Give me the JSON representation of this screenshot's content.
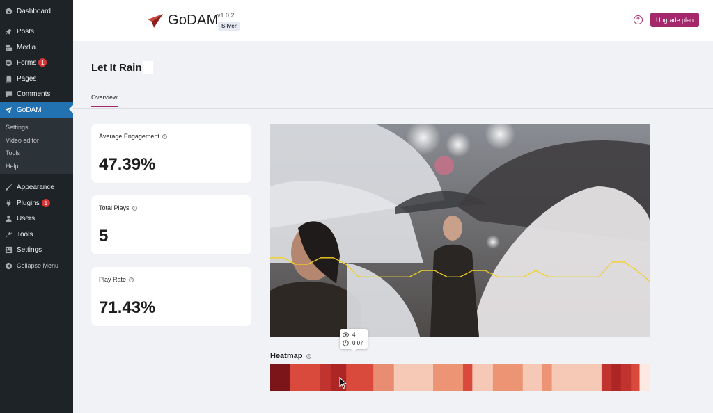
{
  "sidebar": {
    "items": [
      {
        "label": "Dashboard",
        "icon": "dashboard-icon"
      },
      {
        "label": "Posts",
        "icon": "pin-icon"
      },
      {
        "label": "Media",
        "icon": "media-icon"
      },
      {
        "label": "Forms",
        "icon": "forms-icon",
        "badge": "1"
      },
      {
        "label": "Pages",
        "icon": "pages-icon"
      },
      {
        "label": "Comments",
        "icon": "comments-icon"
      },
      {
        "label": "GoDAM",
        "icon": "rocket-icon",
        "active": true
      },
      {
        "label": "Appearance",
        "icon": "brush-icon"
      },
      {
        "label": "Plugins",
        "icon": "plugin-icon",
        "badge": "1"
      },
      {
        "label": "Users",
        "icon": "users-icon"
      },
      {
        "label": "Tools",
        "icon": "wrench-icon"
      },
      {
        "label": "Settings",
        "icon": "settings-icon"
      },
      {
        "label": "Collapse Menu",
        "icon": "collapse-icon"
      }
    ],
    "submenu": [
      "Settings",
      "Video editor",
      "Tools",
      "Help"
    ]
  },
  "header": {
    "logo_text": "GoDAM",
    "version": "v1.0.2",
    "plan": "Silver",
    "help": "?",
    "upgrade_label": "Upgrade plan"
  },
  "page": {
    "title": "Let It Rain",
    "tab": "Overview"
  },
  "metrics": [
    {
      "label": "Average Engagement",
      "value": "47.39%"
    },
    {
      "label": "Total Plays",
      "value": "5"
    },
    {
      "label": "Play Rate",
      "value": "71.43%"
    }
  ],
  "tooltip": {
    "views": "4",
    "time": "0:07"
  },
  "heatmap": {
    "label": "Heatmap",
    "segments": [
      {
        "share": 0.052,
        "color": "#7b1519"
      },
      {
        "share": 0.077,
        "color": "#d9493c"
      },
      {
        "share": 0.027,
        "color": "#c0332e"
      },
      {
        "share": 0.04,
        "color": "#ad2626"
      },
      {
        "share": 0.07,
        "color": "#d9493c"
      },
      {
        "share": 0.053,
        "color": "#e98d72"
      },
      {
        "share": 0.101,
        "color": "#f5c9b6"
      },
      {
        "share": 0.077,
        "color": "#ec9474"
      },
      {
        "share": 0.024,
        "color": "#d9493c"
      },
      {
        "share": 0.053,
        "color": "#f5c9b6"
      },
      {
        "share": 0.077,
        "color": "#ec9474"
      },
      {
        "share": 0.049,
        "color": "#f5c9b6"
      },
      {
        "share": 0.026,
        "color": "#ec9474"
      },
      {
        "share": 0.128,
        "color": "#f5c9b6"
      },
      {
        "share": 0.026,
        "color": "#c0332e"
      },
      {
        "share": 0.024,
        "color": "#ad2626"
      },
      {
        "share": 0.026,
        "color": "#c0332e"
      },
      {
        "share": 0.022,
        "color": "#d9493c"
      },
      {
        "share": 0.026,
        "color": "#fde9e2"
      }
    ]
  },
  "engagement_line": [
    0.63,
    0.63,
    0.66,
    0.66,
    0.63,
    0.63,
    0.66,
    0.72,
    0.72,
    0.72,
    0.72,
    0.72,
    0.69,
    0.69,
    0.72,
    0.72,
    0.69,
    0.69,
    0.72,
    0.72,
    0.72,
    0.69,
    0.72,
    0.72,
    0.72,
    0.72,
    0.72,
    0.65,
    0.65,
    0.69,
    0.74
  ],
  "colors": {
    "accent": "#a4286a",
    "wp_blue": "#2271b1",
    "sidebar_bg": "#1d2327",
    "line": "#f2d21f"
  }
}
